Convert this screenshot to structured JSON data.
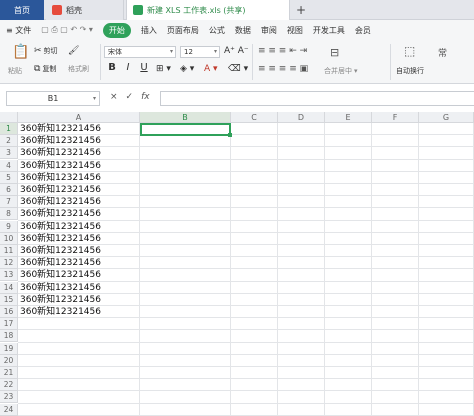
{
  "tabs": {
    "home": "首页",
    "app": "稻壳",
    "doc": "新建 XLS 工作表.xls (共享)",
    "new_tab": "+"
  },
  "menu": {
    "file": "文件",
    "items": [
      "开始",
      "插入",
      "页面布局",
      "公式",
      "数据",
      "审阅",
      "视图",
      "开发工具",
      "会员"
    ]
  },
  "ribbon": {
    "cut": "剪切",
    "copy": "复制",
    "paste": "粘贴",
    "format_painter": "格式刷",
    "font_name": "宋体",
    "font_size": "12",
    "bold": "B",
    "italic": "I",
    "underline": "U",
    "merge": "合并居中",
    "wrap": "自动换行"
  },
  "formula_bar": {
    "name_box": "B1",
    "cancel": "×",
    "confirm": "✓",
    "fx": "fx",
    "value": ""
  },
  "sheet": {
    "columns": [
      "A",
      "B",
      "C",
      "D",
      "E",
      "F",
      "G"
    ],
    "rows": [
      "1",
      "2",
      "3",
      "4",
      "5",
      "6",
      "7",
      "8",
      "9",
      "10",
      "11",
      "12",
      "13",
      "14",
      "15",
      "16",
      "17",
      "18",
      "19",
      "20",
      "21",
      "22",
      "23",
      "24"
    ],
    "cells_A": [
      "360新知12321456",
      "360新知12321456",
      "360新知12321456",
      "360新知12321456",
      "360新知12321456",
      "360新知12321456",
      "360新知12321456",
      "360新知12321456",
      "360新知12321456",
      "360新知12321456",
      "360新知12321456",
      "360新知12321456",
      "360新知12321456",
      "360新知12321456",
      "360新知12321456",
      "360新知12321456"
    ],
    "selected_cell": "B1"
  },
  "colors": {
    "accent": "#2fa15a",
    "home_tab": "#2b579a"
  }
}
